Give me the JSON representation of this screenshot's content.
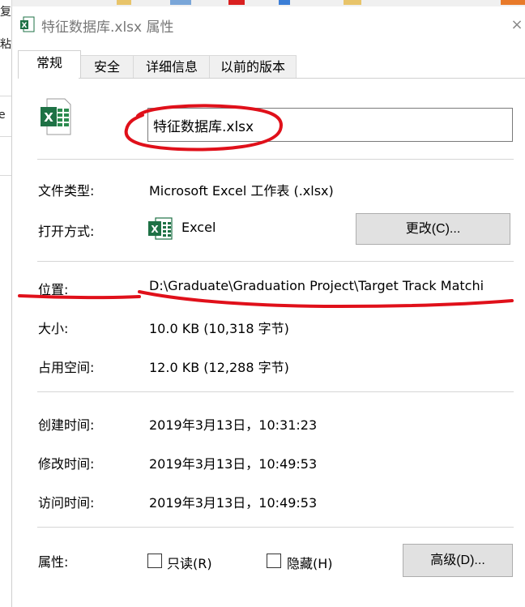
{
  "background": {
    "left_fragments": [
      "复",
      "粘",
      "e"
    ]
  },
  "dialog": {
    "title": "特征数据库.xlsx 属性",
    "close_glyph": "×"
  },
  "tabs": [
    {
      "label": "常规",
      "active": true
    },
    {
      "label": "安全",
      "active": false
    },
    {
      "label": "详细信息",
      "active": false
    },
    {
      "label": "以前的版本",
      "active": false
    }
  ],
  "general": {
    "file_name": "特征数据库.xlsx",
    "file_type_label": "文件类型:",
    "file_type_value": "Microsoft Excel 工作表 (.xlsx)",
    "open_with_label": "打开方式:",
    "open_with_value": "Excel",
    "change_button": "更改(C)...",
    "location_label": "位置:",
    "location_value": "D:\\Graduate\\Graduation Project\\Target Track Matchi",
    "size_label": "大小:",
    "size_value": "10.0 KB (10,318 字节)",
    "size_on_disk_label": "占用空间:",
    "size_on_disk_value": "12.0 KB (12,288 字节)",
    "created_label": "创建时间:",
    "created_value": "2019年3月13日，10:31:23",
    "modified_label": "修改时间:",
    "modified_value": "2019年3月13日，10:49:53",
    "accessed_label": "访问时间:",
    "accessed_value": "2019年3月13日，10:49:53",
    "attributes_label": "属性:",
    "readonly_label": "只读(R)",
    "readonly_checked": false,
    "hidden_label": "隐藏(H)",
    "hidden_checked": false,
    "advanced_button": "高级(D)..."
  },
  "colors": {
    "excel_green": "#1e7145",
    "annotation_red": "#e0101a",
    "button_face": "#e1e1e1"
  },
  "icons": {
    "title_icon": "excel-file-icon",
    "file_icon": "excel-file-icon",
    "open_with_icon": "excel-app-icon"
  }
}
